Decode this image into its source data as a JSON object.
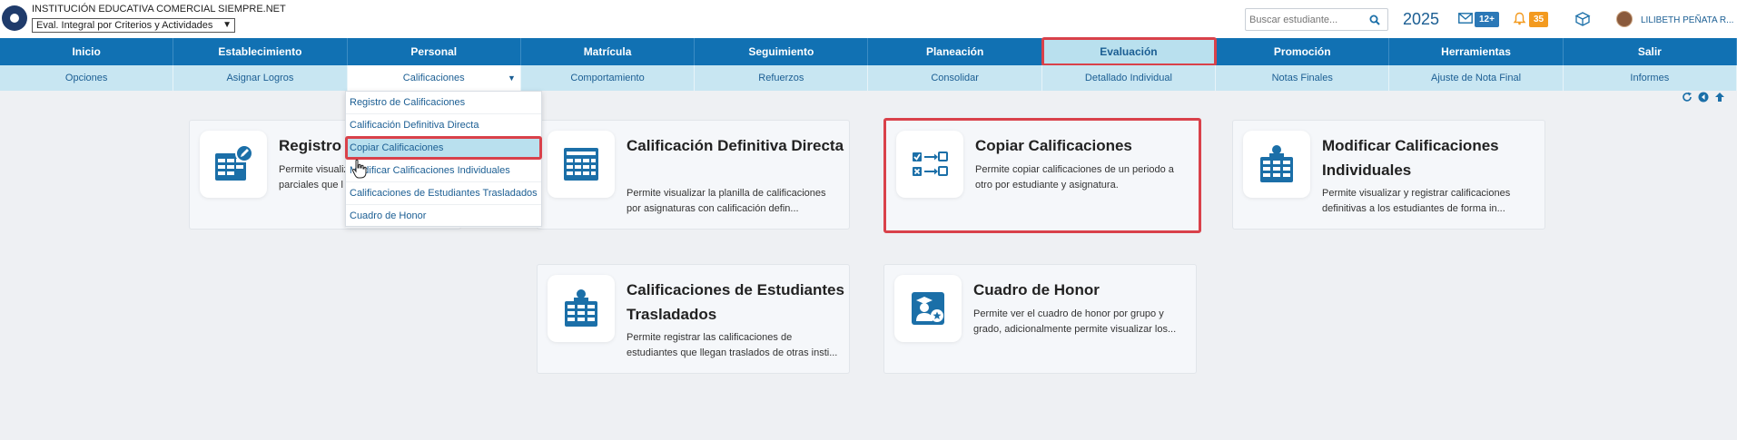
{
  "header": {
    "institution": "INSTITUCIÓN EDUCATIVA COMERCIAL SIEMPRE.NET",
    "eval_select": "Eval. Integral por Criterios y Actividades",
    "search_placeholder": "Buscar estudiante...",
    "year": "2025",
    "mail_count": "12+",
    "notification_count": "35",
    "user_name": "LILIBETH PEÑATA R..."
  },
  "main_nav": [
    "Inicio",
    "Establecimiento",
    "Personal",
    "Matrícula",
    "Seguimiento",
    "Planeación",
    "Evaluación",
    "Promoción",
    "Herramientas",
    "Salir"
  ],
  "sub_nav": [
    "Opciones",
    "Asignar Logros",
    "Calificaciones",
    "Comportamiento",
    "Refuerzos",
    "Consolidar",
    "Detallado Individual",
    "Notas Finales",
    "Ajuste de Nota Final",
    "Informes"
  ],
  "dropdown": [
    "Registro de Calificaciones",
    "Calificación Definitiva Directa",
    "Copiar Calificaciones",
    "Modificar Calificaciones Individuales",
    "Calificaciones de Estudiantes Trasladados",
    "Cuadro de Honor"
  ],
  "cards": {
    "registro": {
      "title": "Registro",
      "desc": "Permite visualizar",
      "desc2": "parciales que l"
    },
    "definitiva": {
      "title": "Calificación Definitiva Directa",
      "desc": "Permite visualizar la planilla de calificaciones por asignaturas con calificación defin..."
    },
    "copiar": {
      "title": "Copiar Calificaciones",
      "desc": "Permite copiar calificaciones de un periodo a otro por estudiante y asignatura."
    },
    "modificar": {
      "title": "Modificar Calificaciones Individuales",
      "desc": "Permite visualizar y registrar calificaciones definitivas a los estudiantes de forma in..."
    },
    "trasladados": {
      "title": "Calificaciones de Estudiantes Trasladados",
      "desc": "Permite registrar las calificaciones de estudiantes que llegan traslados de otras insti..."
    },
    "honor": {
      "title": "Cuadro de Honor",
      "desc": "Permite ver el cuadro de honor por grupo y grado, adicionalmente permite visualizar los..."
    }
  },
  "colors": {
    "nav": "#1171b3",
    "subnav": "#c8e6f2",
    "active": "#b9e0ee",
    "highlight": "#d9414a",
    "icon": "#1b6fa8"
  }
}
